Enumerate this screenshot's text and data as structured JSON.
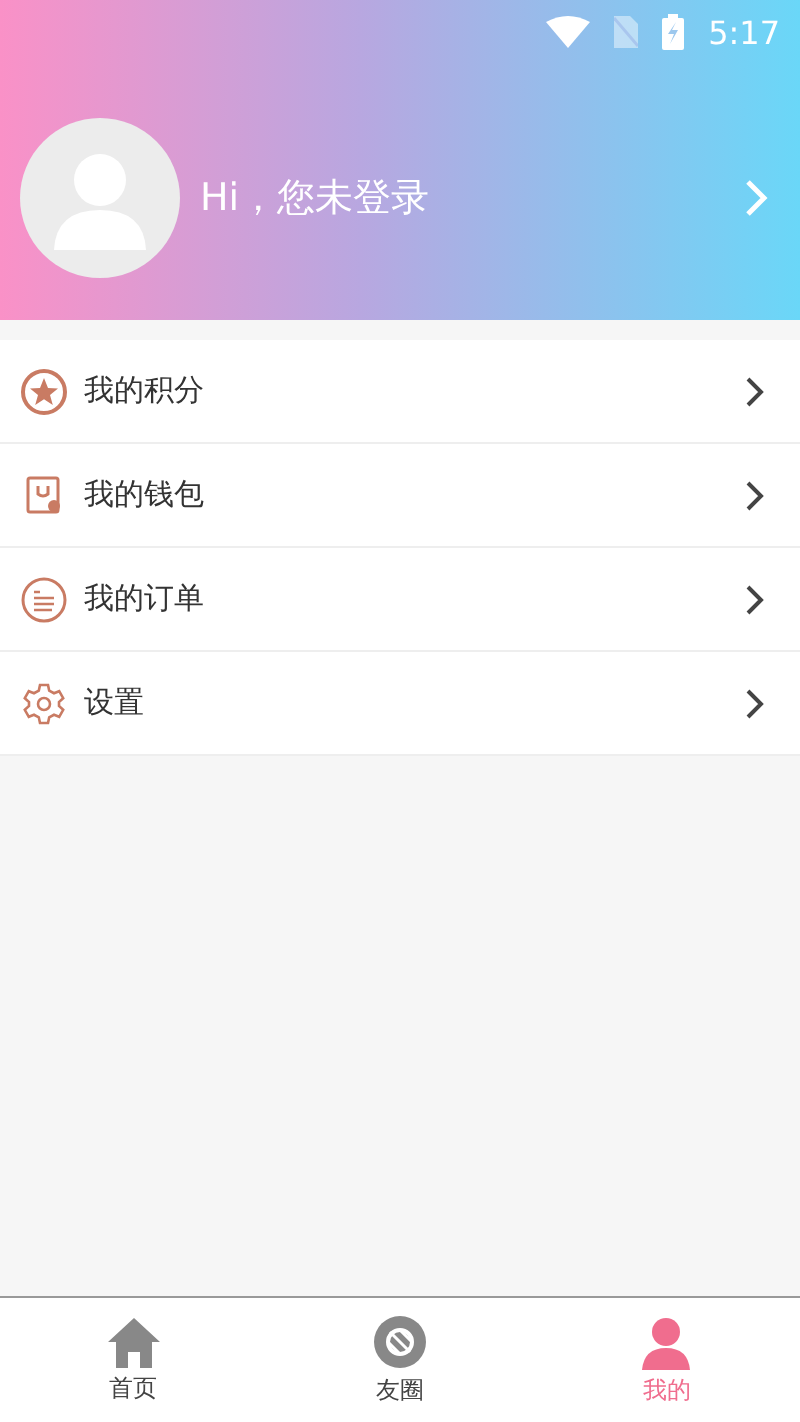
{
  "status_bar": {
    "time": "5:17"
  },
  "profile": {
    "greeting": "Hi，您未登录"
  },
  "menu": [
    {
      "kind": "star",
      "label": "我的积分"
    },
    {
      "kind": "wallet",
      "label": "我的钱包"
    },
    {
      "kind": "order",
      "label": "我的订单"
    },
    {
      "kind": "gear",
      "label": "设置"
    }
  ],
  "tabs": [
    {
      "kind": "home",
      "label": "首页",
      "selected": false
    },
    {
      "kind": "aperture",
      "label": "友圈",
      "selected": false
    },
    {
      "kind": "person",
      "label": "我的",
      "selected": true
    }
  ]
}
